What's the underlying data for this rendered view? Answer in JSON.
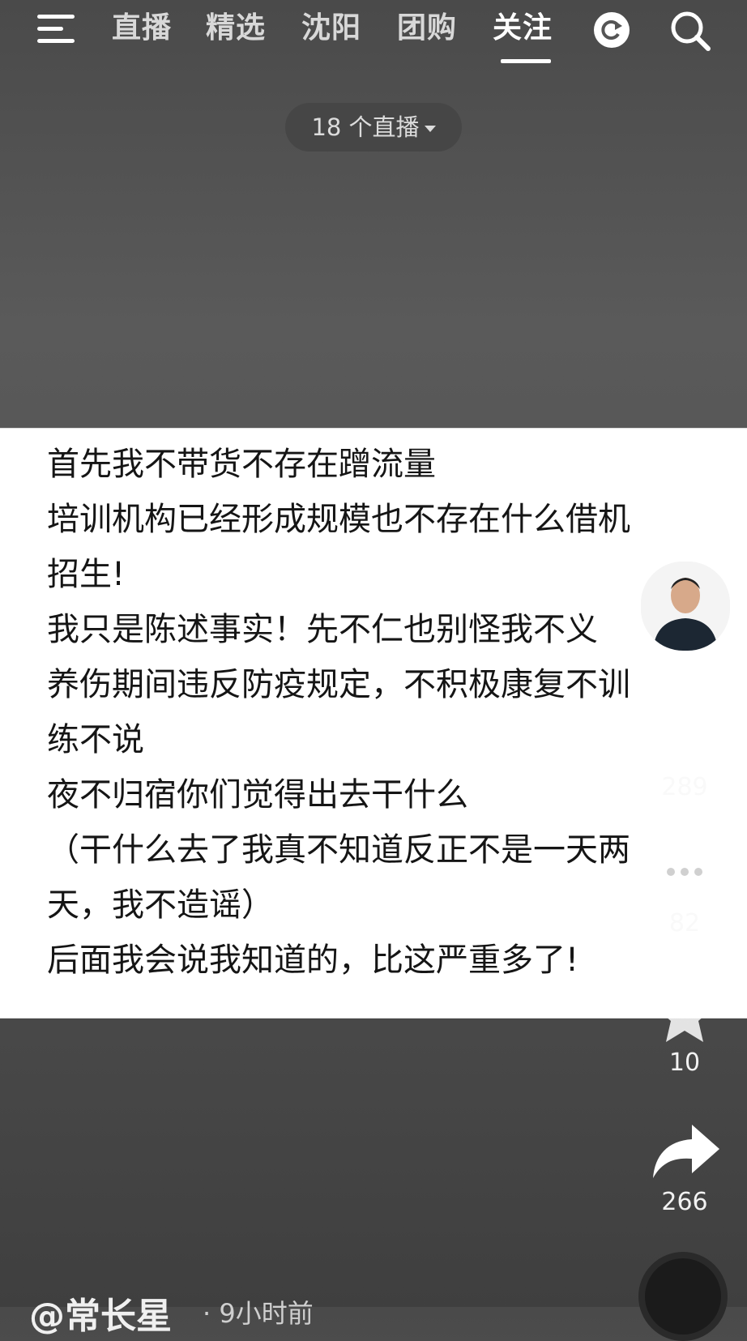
{
  "top_nav": {
    "tabs": [
      {
        "label": "直播"
      },
      {
        "label": "精选"
      },
      {
        "label": "沈阳"
      },
      {
        "label": "团购"
      },
      {
        "label": "关注"
      }
    ],
    "active_tab": "关注",
    "icons": [
      "menu-icon",
      "refresh-icon",
      "search-icon"
    ]
  },
  "live_pill": {
    "label": "18 个直播"
  },
  "note": {
    "lines": [
      "首先我不带货不存在蹭流量",
      "培训机构已经形成规模也不存在什么借机",
      "招生!",
      "我只是陈述事实！先不仁也别怪我不义",
      "养伤期间违反防疫规定，不积极康复不训",
      "练不说",
      "夜不归宿你们觉得出去干什么",
      "（干什么去了我真不知道反正不是一天两",
      "天，我不造谣）",
      "后面我会说我知道的，比这严重多了!"
    ]
  },
  "side_actions": {
    "like_count": "289",
    "comment_count": "82",
    "favorite_count": "10",
    "share_count": "266"
  },
  "footer": {
    "username": "@常长星",
    "time": "· 9小时前"
  },
  "colors": {
    "background": "#4f4f4f",
    "note_bg": "#ffffff",
    "text": "#151515"
  }
}
